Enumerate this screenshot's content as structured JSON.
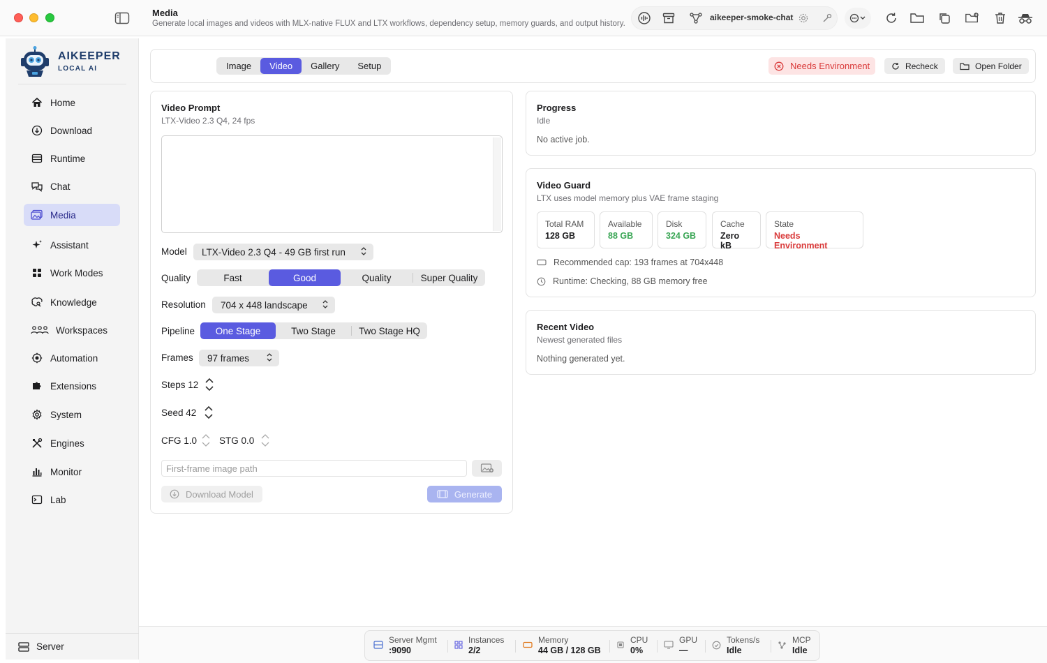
{
  "header": {
    "title": "Media",
    "subtitle": "Generate local images and videos with MLX-native FLUX and LTX workflows, dependency setup, memory guards, and output history.",
    "chat_name": "aikeeper-smoke-chat"
  },
  "brand": {
    "name": "AIKEEPER",
    "tagline": "LOCAL AI"
  },
  "sidebar": {
    "items": [
      {
        "label": "Home",
        "icon": "home-icon"
      },
      {
        "label": "Download",
        "icon": "download-icon"
      },
      {
        "label": "Runtime",
        "icon": "runtime-icon"
      },
      {
        "label": "Chat",
        "icon": "chat-icon"
      },
      {
        "label": "Media",
        "icon": "media-icon"
      },
      {
        "label": "Assistant",
        "icon": "sparkle-icon"
      },
      {
        "label": "Work Modes",
        "icon": "grid-icon"
      },
      {
        "label": "Knowledge",
        "icon": "brain-icon"
      },
      {
        "label": "Workspaces",
        "icon": "people-icon"
      },
      {
        "label": "Automation",
        "icon": "automation-icon"
      },
      {
        "label": "Extensions",
        "icon": "puzzle-icon"
      },
      {
        "label": "System",
        "icon": "gear-icon"
      },
      {
        "label": "Engines",
        "icon": "tools-icon"
      },
      {
        "label": "Monitor",
        "icon": "chart-icon"
      },
      {
        "label": "Lab",
        "icon": "lab-icon"
      }
    ],
    "active": "Media",
    "bottom_label": "Server"
  },
  "tabs": {
    "items": [
      "Image",
      "Video",
      "Gallery",
      "Setup"
    ],
    "active": "Video",
    "status_badge": "Needs Environment",
    "recheck_label": "Recheck",
    "open_folder_label": "Open Folder"
  },
  "video_prompt": {
    "title": "Video Prompt",
    "subtitle": "LTX-Video 2.3 Q4, 24 fps",
    "prompt_value": "",
    "model_label": "Model",
    "model_value": "LTX-Video 2.3 Q4 - 49 GB first run",
    "quality_label": "Quality",
    "quality_options": [
      "Fast",
      "Good",
      "Quality",
      "Super Quality"
    ],
    "quality_selected": "Good",
    "resolution_label": "Resolution",
    "resolution_value": "704 x 448 landscape",
    "pipeline_label": "Pipeline",
    "pipeline_options": [
      "One Stage",
      "Two Stage",
      "Two Stage HQ"
    ],
    "pipeline_selected": "One Stage",
    "frames_label": "Frames",
    "frames_value": "97 frames",
    "steps_text": "Steps 12",
    "seed_text": "Seed 42",
    "cfg_text": "CFG 1.0",
    "stg_text": "STG 0.0",
    "image_path_placeholder": "First-frame image path",
    "download_label": "Download Model",
    "generate_label": "Generate"
  },
  "progress": {
    "title": "Progress",
    "status": "Idle",
    "message": "No active job."
  },
  "video_guard": {
    "title": "Video Guard",
    "subtitle": "LTX uses model memory plus VAE frame staging",
    "stats": [
      {
        "label": "Total RAM",
        "value": "128 GB",
        "color": "#1d1d1f"
      },
      {
        "label": "Available",
        "value": "88 GB",
        "color": "#3aa655"
      },
      {
        "label": "Disk",
        "value": "324 GB",
        "color": "#3aa655"
      },
      {
        "label": "Cache",
        "value": "Zero kB",
        "color": "#1d1d1f"
      },
      {
        "label": "State",
        "value": "Needs Environment",
        "color": "#d93a3a"
      }
    ],
    "recommended": "Recommended cap: 193 frames at 704x448",
    "runtime": "Runtime: Checking, 88 GB memory free"
  },
  "recent_video": {
    "title": "Recent Video",
    "subtitle": "Newest generated files",
    "message": "Nothing generated yet."
  },
  "statusbar": {
    "items": [
      {
        "label": "Server Mgmt",
        "value": ":9090"
      },
      {
        "label": "Instances",
        "value": "2/2"
      },
      {
        "label": "Memory",
        "value": "44 GB / 128 GB"
      },
      {
        "label": "CPU",
        "value": "0%"
      },
      {
        "label": "GPU",
        "value": "—"
      },
      {
        "label": "Tokens/s",
        "value": "Idle"
      },
      {
        "label": "MCP",
        "value": "Idle"
      }
    ]
  },
  "colors": {
    "accent": "#5a5be0",
    "error": "#d93a3a",
    "ok": "#3aa655",
    "sidebar_active": "#d8dcf8"
  }
}
